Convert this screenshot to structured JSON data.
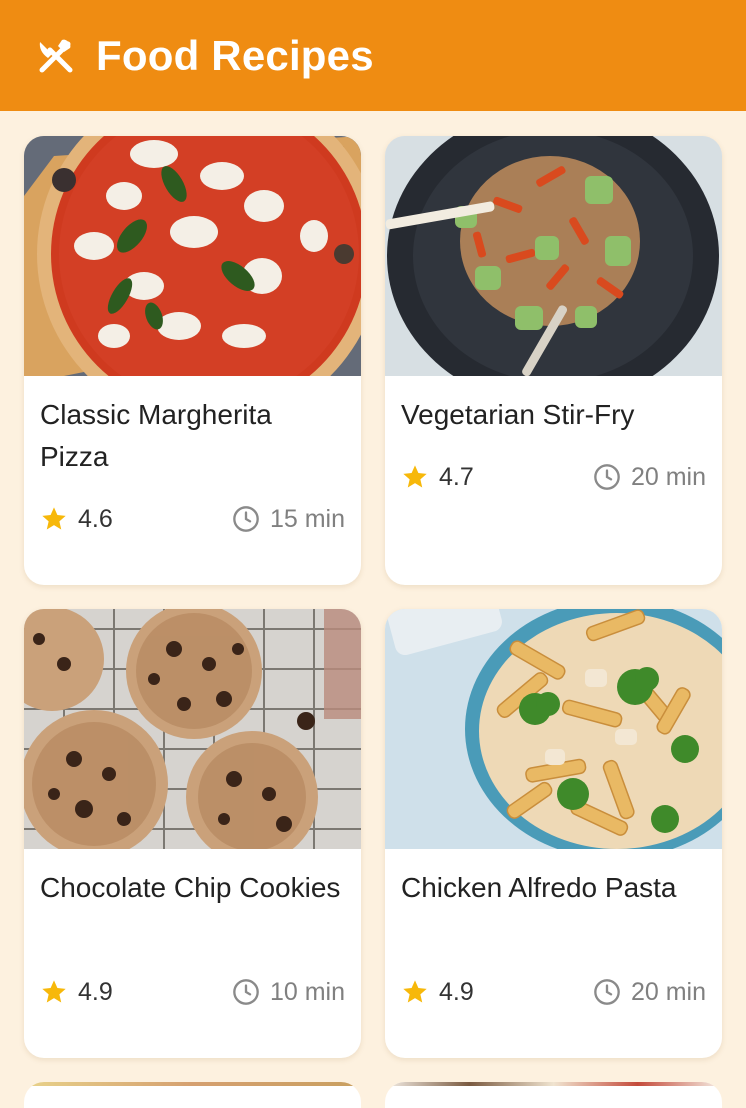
{
  "app": {
    "title": "Food Recipes",
    "accent_color": "#ef8c12",
    "background_color": "#fdf1df",
    "logo_icon": "fork-knife-icon"
  },
  "recipes": [
    {
      "name": "Classic Margherita Pizza",
      "rating": "4.6",
      "time": "15 min",
      "image": "margherita-pizza-photo"
    },
    {
      "name": "Vegetarian Stir-Fry",
      "rating": "4.7",
      "time": "20 min",
      "image": "stir-fry-photo"
    },
    {
      "name": "Chocolate Chip Cookies",
      "rating": "4.9",
      "time": "10 min",
      "image": "cookies-photo"
    },
    {
      "name": "Chicken Alfredo Pasta",
      "rating": "4.9",
      "time": "20 min",
      "image": "alfredo-pasta-photo"
    }
  ],
  "icons": {
    "rating": "star-icon",
    "time": "clock-icon"
  },
  "colors": {
    "star": "#f7b80a",
    "clock": "#8a8a8a",
    "text_primary": "#222222",
    "text_secondary": "#808080"
  }
}
